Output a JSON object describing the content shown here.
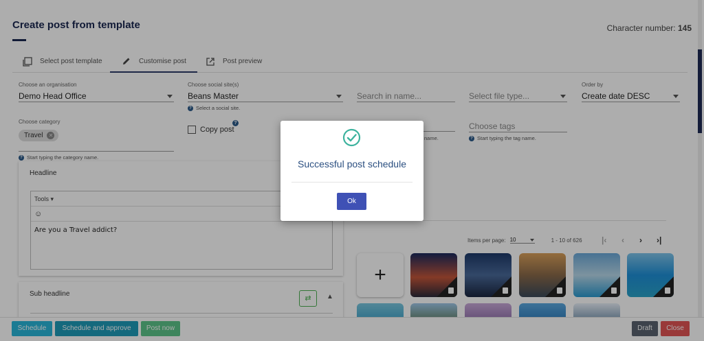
{
  "header": {
    "title": "Create post from template",
    "char_label": "Character number:",
    "char_count": "145"
  },
  "tabs": [
    {
      "label": "Select post template",
      "icon": "template-icon"
    },
    {
      "label": "Customise post",
      "icon": "pencil-icon"
    },
    {
      "label": "Post preview",
      "icon": "external-link-icon"
    }
  ],
  "form": {
    "org_label": "Choose an organisation",
    "org_value": "Demo Head Office",
    "social_label": "Choose social site(s)",
    "social_value": "Beans Master",
    "social_hint": "Select a social site.",
    "search_placeholder": "Search in name...",
    "filetype_placeholder": "Select file type...",
    "order_label": "Order by",
    "order_value": "Create date DESC",
    "category_label": "Choose category",
    "category_chip": "Travel",
    "category_hint": "Start typing the category name.",
    "copy_post_label": "Copy post",
    "name_hint_fragment": "name.",
    "tags_placeholder": "Choose tags",
    "tags_hint": "Start typing the tag name."
  },
  "headline": {
    "label": "Headline",
    "tools_label": "Tools",
    "text": "Are you a Travel addict?"
  },
  "subheadline": {
    "label": "Sub headline"
  },
  "gallery": {
    "items_per_page_label": "Items per page:",
    "items_per_page": "10",
    "range": "1 - 10 of 626"
  },
  "footer": {
    "schedule": "Schedule",
    "schedule_approve": "Schedule and approve",
    "post_now": "Post now",
    "draft": "Draft",
    "close": "Close"
  },
  "dialog": {
    "message": "Successful post schedule",
    "ok": "Ok"
  },
  "colors": {
    "primary": "#1a2750",
    "schedule": "#29b6d9",
    "schedule_approve": "#1e9bb8",
    "post_now": "#5cc48a",
    "draft": "#5a6470",
    "close": "#e25454",
    "ok": "#3f51b5",
    "success": "#3db39e"
  }
}
